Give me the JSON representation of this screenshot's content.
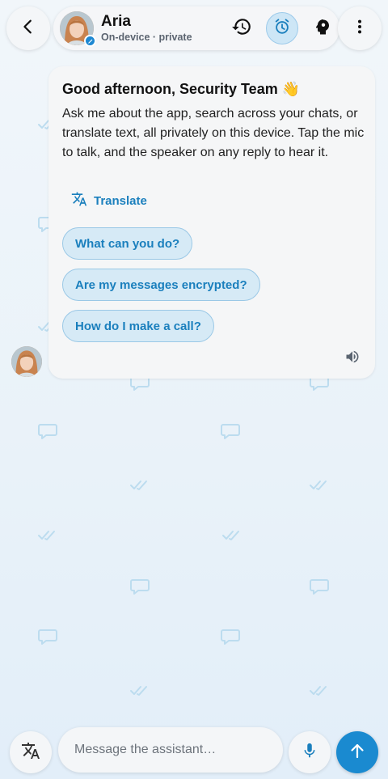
{
  "header": {
    "contact_name": "Aria",
    "contact_status": "On-device · private",
    "icons": [
      "back-icon",
      "history-icon",
      "alarm-icon",
      "brain-icon",
      "more-vert-icon"
    ]
  },
  "message": {
    "greeting": "Good afternoon, Security Team 👋",
    "body": "Ask me about the app, search across your chats, or translate text, all privately on this device. Tap the mic to talk, and the speaker on any reply to hear it.",
    "translate_label": "Translate",
    "suggestions": [
      "What can you do?",
      "Are my messages encrypted?",
      "How do I make a call?"
    ]
  },
  "composer": {
    "placeholder": "Message the assistant…"
  },
  "colors": {
    "accent": "#1a8ad0",
    "link": "#1a7fbd",
    "chip_bg": "#d6eaf6",
    "pattern": "#bcdcef"
  }
}
